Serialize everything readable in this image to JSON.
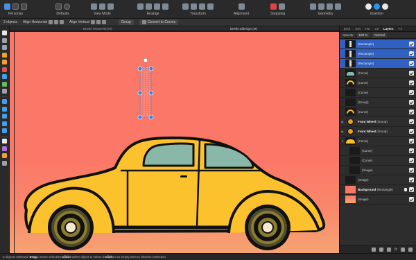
{
  "toolbar": {
    "groups": [
      {
        "key": "personas",
        "label": "Personas"
      },
      {
        "key": "defaults",
        "label": "Defaults"
      },
      {
        "key": "view_mode",
        "label": "View Mode"
      },
      {
        "key": "arrange",
        "label": "Arrange"
      },
      {
        "key": "transform",
        "label": "Transform"
      },
      {
        "key": "alignment",
        "label": "Alignment"
      },
      {
        "key": "snapping",
        "label": "Snapping"
      },
      {
        "key": "geometry",
        "label": "Geometry"
      },
      {
        "key": "insertion",
        "label": "Insertion"
      }
    ]
  },
  "context": {
    "selection": "3 objects",
    "align_horizontal": "Align Horizontal",
    "align_vertical": "Align Vertical",
    "group": "Group",
    "convert_to_curves": "Convert to Curves"
  },
  "document": {
    "tab_left": "Beetle (RGBA/8) (M)",
    "tab_title": "Beetle.afdesign (M)"
  },
  "panel": {
    "tabs": [
      "Brsh",
      "Swt",
      "Hst",
      "Ctl",
      "Layers",
      "FX"
    ],
    "active_tab": "Layers",
    "opacity_label": "Opacity:",
    "opacity_value": "100 %",
    "blend_mode": "Normal",
    "layers": [
      {
        "indent": 0,
        "expander": "",
        "name": "(Rectangle)",
        "selected": true,
        "checked": true,
        "thumb": "rect"
      },
      {
        "indent": 0,
        "expander": "",
        "name": "(Rectangle)",
        "selected": true,
        "checked": true,
        "thumb": "rect"
      },
      {
        "indent": 0,
        "expander": "",
        "name": "(Rectangle)",
        "selected": true,
        "checked": true,
        "thumb": "rect"
      },
      {
        "indent": 0,
        "expander": "",
        "name": "(Curve)",
        "selected": false,
        "checked": true,
        "thumb": "window"
      },
      {
        "indent": 0,
        "expander": "",
        "name": "(Curve)",
        "selected": false,
        "checked": true,
        "thumb": "arc"
      },
      {
        "indent": 0,
        "expander": "",
        "name": "(Curve)",
        "selected": false,
        "checked": true,
        "thumb": "blank"
      },
      {
        "indent": 0,
        "expander": "",
        "name": "(Group)",
        "selected": false,
        "checked": true,
        "thumb": "blank"
      },
      {
        "indent": 0,
        "expander": "",
        "name": "(Curve)",
        "selected": false,
        "checked": true,
        "thumb": "arc"
      },
      {
        "indent": 0,
        "expander": "▶",
        "name_bold": "Front Wheel",
        "name_suffix": " (Group)",
        "selected": false,
        "checked": true,
        "thumb": "wheel"
      },
      {
        "indent": 0,
        "expander": "▶",
        "name_bold": "Front Wheel",
        "name_suffix": " (Group)",
        "selected": false,
        "checked": true,
        "thumb": "wheel"
      },
      {
        "indent": 0,
        "expander": "▼",
        "name": "(Curve)",
        "selected": false,
        "checked": true,
        "thumb": "car"
      },
      {
        "indent": 1,
        "expander": "",
        "name": "(Curve)",
        "selected": false,
        "checked": true,
        "thumb": "blank"
      },
      {
        "indent": 1,
        "expander": "",
        "name": "(Curve)",
        "selected": false,
        "checked": true,
        "thumb": "blank"
      },
      {
        "indent": 1,
        "expander": "",
        "name": "(Image)",
        "selected": false,
        "checked": true,
        "thumb": "blank"
      },
      {
        "indent": 0,
        "expander": "",
        "name": "(Image)",
        "selected": false,
        "checked": true,
        "thumb": "blank"
      },
      {
        "indent": 0,
        "expander": "",
        "name_bold": "Background",
        "name_suffix": " (Rectangle)",
        "selected": false,
        "checked": true,
        "lock": true,
        "thumb": "bg"
      },
      {
        "indent": 0,
        "expander": "",
        "name": "(Image)",
        "selected": false,
        "checked": true,
        "thumb": "img"
      }
    ],
    "footer_fx": "fx"
  },
  "status": {
    "count": "3 objects selected.",
    "drag": "Drag",
    "drag_text": " to move selection. ",
    "click": "Click",
    "click_text": " another object to select it. ",
    "click2": "Click",
    "click2_text": " on an empty area to deselect selection."
  },
  "colors": {
    "background": "#fb7868",
    "car_body": "#fcc22e",
    "car_window": "#8ab8a8",
    "selection": "#3060c0"
  }
}
